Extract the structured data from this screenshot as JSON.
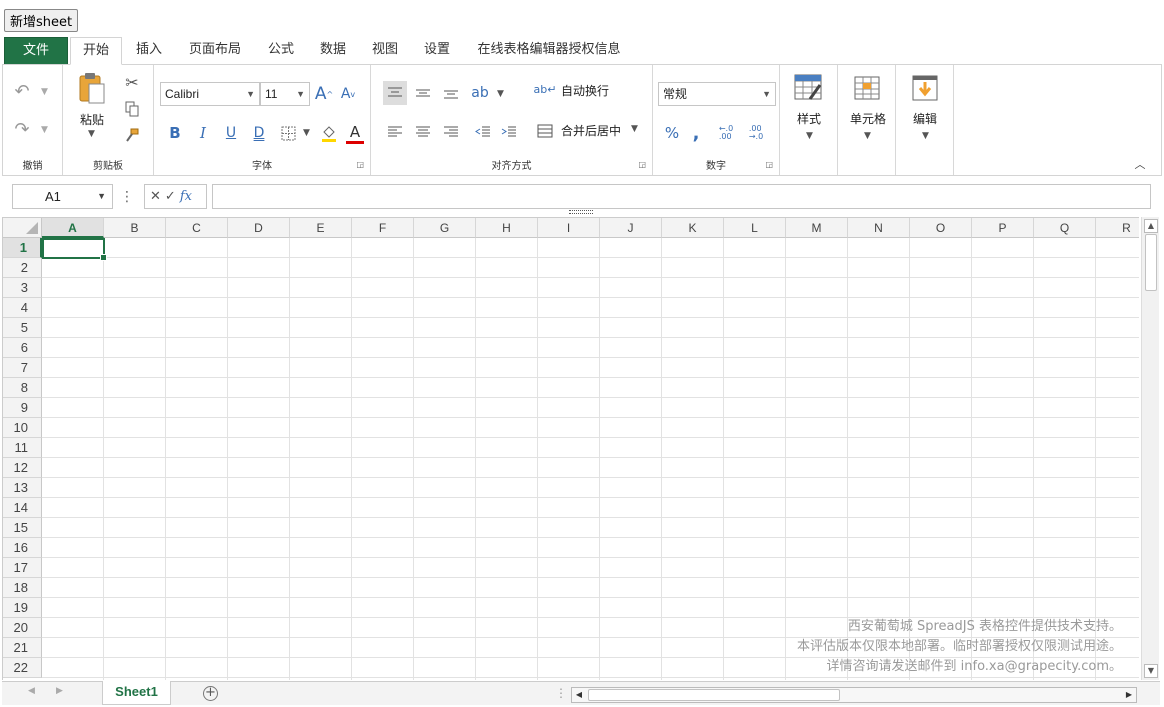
{
  "top_button": "新增sheet",
  "tabs": [
    "文件",
    "开始",
    "插入",
    "页面布局",
    "公式",
    "数据",
    "视图",
    "设置",
    "在线表格编辑器授权信息"
  ],
  "ribbon": {
    "undo_group": "撤销",
    "clipboard": {
      "paste": "粘贴",
      "label": "剪贴板"
    },
    "font": {
      "name": "Calibri",
      "size": "11",
      "label": "字体"
    },
    "alignment": {
      "wrap": "自动换行",
      "merge": "合并后居中",
      "label": "对齐方式"
    },
    "number": {
      "format": "常规",
      "label": "数字"
    },
    "styles": "样式",
    "cells": "单元格",
    "editing": "编辑"
  },
  "formula_bar": {
    "name_box": "A1",
    "value": ""
  },
  "columns": [
    "A",
    "B",
    "C",
    "D",
    "E",
    "F",
    "G",
    "H",
    "I",
    "J",
    "K",
    "L",
    "M",
    "N",
    "O",
    "P",
    "Q",
    "R"
  ],
  "rows": [
    "1",
    "2",
    "3",
    "4",
    "5",
    "6",
    "7",
    "8",
    "9",
    "10",
    "11",
    "12",
    "13",
    "14",
    "15",
    "16",
    "17",
    "18",
    "19",
    "20",
    "21",
    "22"
  ],
  "watermark": {
    "line1": "西安葡萄城 SpreadJS 表格控件提供技术支持。",
    "line2": "本评估版本仅限本地部署。临时部署授权仅限测试用途。",
    "line3": "详情咨询请发送邮件到 info.xa@grapecity.com。"
  },
  "sheet_tab": "Sheet1",
  "colors": {
    "accent": "#217346",
    "grid": "#e2e2e2",
    "header": "#f3f3f3"
  }
}
